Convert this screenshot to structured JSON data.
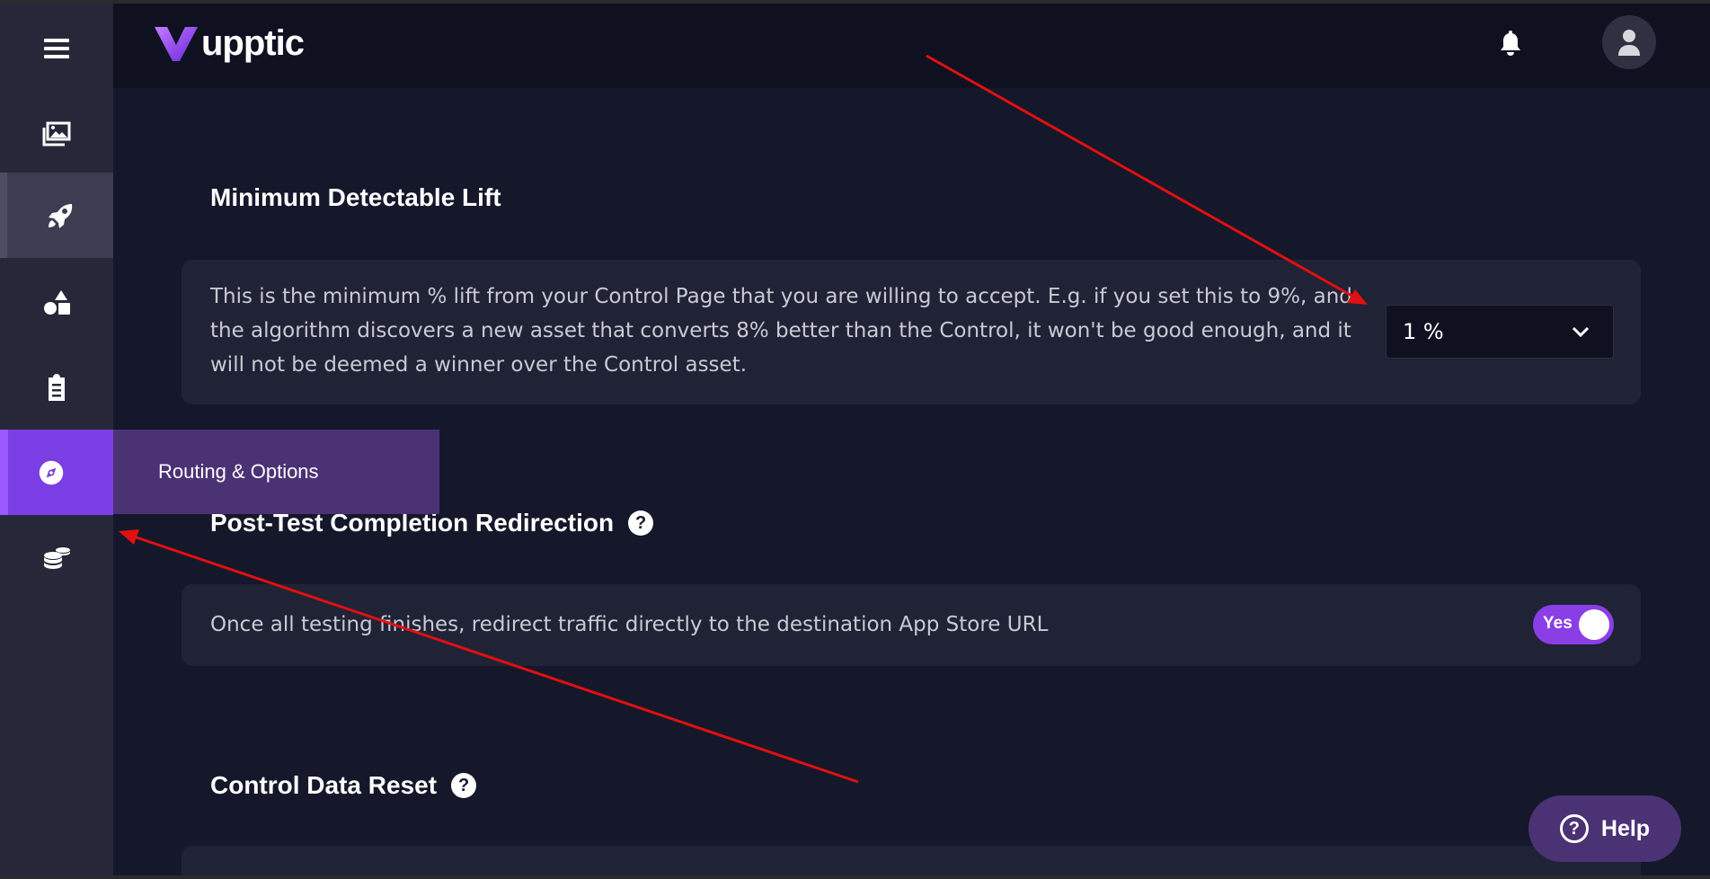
{
  "brand": {
    "name": "upptic"
  },
  "sidebar": {
    "items": [
      {
        "name": "menu",
        "icon": "hamburger-icon"
      },
      {
        "name": "media",
        "icon": "images-icon"
      },
      {
        "name": "launch",
        "icon": "rocket-icon"
      },
      {
        "name": "shapes",
        "icon": "shapes-icon"
      },
      {
        "name": "clipboard",
        "icon": "clipboard-list-icon"
      },
      {
        "name": "routing",
        "icon": "compass-icon",
        "active": true
      },
      {
        "name": "coins",
        "icon": "coins-icon"
      }
    ],
    "tooltip": "Routing & Options"
  },
  "header": {
    "notification_icon": "bell-icon",
    "avatar_icon": "user-icon"
  },
  "sections": {
    "mdl": {
      "title": "Minimum Detectable Lift",
      "description": "This is the minimum % lift from your Control Page that you are willing to accept. E.g. if you set this to 9%, and the algorithm discovers a new asset that converts 8% better than the Control, it won't be good enough, and it will not be deemed a winner over the Control asset.",
      "select_value": "1 %"
    },
    "redirect": {
      "title": "Post-Test Completion Redirection",
      "description": "Once all testing finishes, redirect traffic directly to the destination App Store URL",
      "toggle_label": "Yes",
      "toggle_on": true
    },
    "reset": {
      "title": "Control Data Reset"
    }
  },
  "help": {
    "label": "Help",
    "icon": "question-circle-icon"
  },
  "colors": {
    "accent": "#8a3ee6",
    "annotation": "#e01010",
    "background": "#15172a",
    "sidebar": "#262839"
  }
}
